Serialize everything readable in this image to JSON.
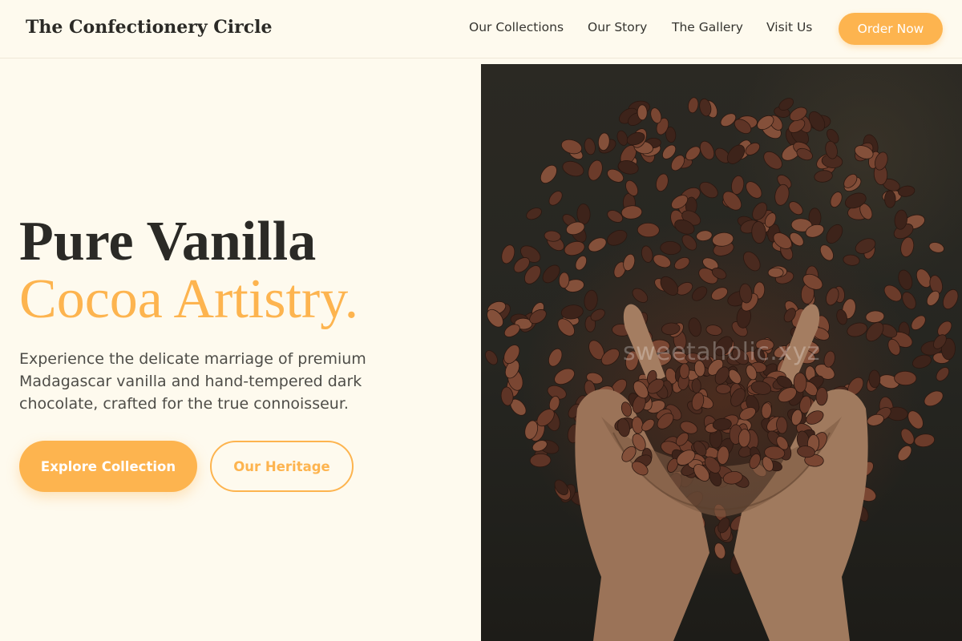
{
  "header": {
    "brand": "The Confectionery Circle",
    "nav": {
      "collections": "Our Collections",
      "story": "Our Story",
      "gallery": "The Gallery",
      "visit": "Visit Us"
    },
    "order_button": "Order Now"
  },
  "hero": {
    "headline_line1": "Pure Vanilla",
    "headline_line2": "Cocoa Artistry.",
    "lead": "Experience the delicate marriage of premium Madagascar vanilla and hand-tempered dark chocolate, crafted for the true connoisseur.",
    "primary_button": "Explore Collection",
    "secondary_button": "Our Heritage",
    "image": {
      "subject": "hands-holding-cocoa-beans",
      "watermark": "sweetaholic.xyz"
    }
  },
  "colors": {
    "background": "#fefaee",
    "accent": "#fdb44f",
    "text_dark": "#2b2a26",
    "text_muted": "#4e4d48"
  }
}
